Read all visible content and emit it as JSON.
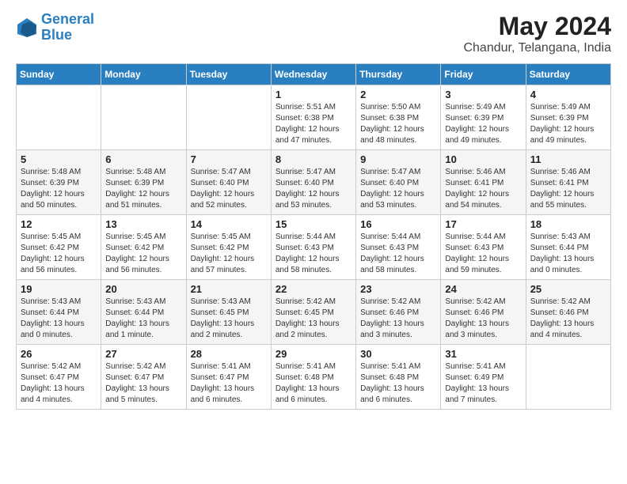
{
  "logo": {
    "line1": "General",
    "line2": "Blue"
  },
  "title": "May 2024",
  "subtitle": "Chandur, Telangana, India",
  "days_of_week": [
    "Sunday",
    "Monday",
    "Tuesday",
    "Wednesday",
    "Thursday",
    "Friday",
    "Saturday"
  ],
  "weeks": [
    [
      {
        "day": "",
        "info": ""
      },
      {
        "day": "",
        "info": ""
      },
      {
        "day": "",
        "info": ""
      },
      {
        "day": "1",
        "info": "Sunrise: 5:51 AM\nSunset: 6:38 PM\nDaylight: 12 hours\nand 47 minutes."
      },
      {
        "day": "2",
        "info": "Sunrise: 5:50 AM\nSunset: 6:38 PM\nDaylight: 12 hours\nand 48 minutes."
      },
      {
        "day": "3",
        "info": "Sunrise: 5:49 AM\nSunset: 6:39 PM\nDaylight: 12 hours\nand 49 minutes."
      },
      {
        "day": "4",
        "info": "Sunrise: 5:49 AM\nSunset: 6:39 PM\nDaylight: 12 hours\nand 49 minutes."
      }
    ],
    [
      {
        "day": "5",
        "info": "Sunrise: 5:48 AM\nSunset: 6:39 PM\nDaylight: 12 hours\nand 50 minutes."
      },
      {
        "day": "6",
        "info": "Sunrise: 5:48 AM\nSunset: 6:39 PM\nDaylight: 12 hours\nand 51 minutes."
      },
      {
        "day": "7",
        "info": "Sunrise: 5:47 AM\nSunset: 6:40 PM\nDaylight: 12 hours\nand 52 minutes."
      },
      {
        "day": "8",
        "info": "Sunrise: 5:47 AM\nSunset: 6:40 PM\nDaylight: 12 hours\nand 53 minutes."
      },
      {
        "day": "9",
        "info": "Sunrise: 5:47 AM\nSunset: 6:40 PM\nDaylight: 12 hours\nand 53 minutes."
      },
      {
        "day": "10",
        "info": "Sunrise: 5:46 AM\nSunset: 6:41 PM\nDaylight: 12 hours\nand 54 minutes."
      },
      {
        "day": "11",
        "info": "Sunrise: 5:46 AM\nSunset: 6:41 PM\nDaylight: 12 hours\nand 55 minutes."
      }
    ],
    [
      {
        "day": "12",
        "info": "Sunrise: 5:45 AM\nSunset: 6:42 PM\nDaylight: 12 hours\nand 56 minutes."
      },
      {
        "day": "13",
        "info": "Sunrise: 5:45 AM\nSunset: 6:42 PM\nDaylight: 12 hours\nand 56 minutes."
      },
      {
        "day": "14",
        "info": "Sunrise: 5:45 AM\nSunset: 6:42 PM\nDaylight: 12 hours\nand 57 minutes."
      },
      {
        "day": "15",
        "info": "Sunrise: 5:44 AM\nSunset: 6:43 PM\nDaylight: 12 hours\nand 58 minutes."
      },
      {
        "day": "16",
        "info": "Sunrise: 5:44 AM\nSunset: 6:43 PM\nDaylight: 12 hours\nand 58 minutes."
      },
      {
        "day": "17",
        "info": "Sunrise: 5:44 AM\nSunset: 6:43 PM\nDaylight: 12 hours\nand 59 minutes."
      },
      {
        "day": "18",
        "info": "Sunrise: 5:43 AM\nSunset: 6:44 PM\nDaylight: 13 hours\nand 0 minutes."
      }
    ],
    [
      {
        "day": "19",
        "info": "Sunrise: 5:43 AM\nSunset: 6:44 PM\nDaylight: 13 hours\nand 0 minutes."
      },
      {
        "day": "20",
        "info": "Sunrise: 5:43 AM\nSunset: 6:44 PM\nDaylight: 13 hours\nand 1 minute."
      },
      {
        "day": "21",
        "info": "Sunrise: 5:43 AM\nSunset: 6:45 PM\nDaylight: 13 hours\nand 2 minutes."
      },
      {
        "day": "22",
        "info": "Sunrise: 5:42 AM\nSunset: 6:45 PM\nDaylight: 13 hours\nand 2 minutes."
      },
      {
        "day": "23",
        "info": "Sunrise: 5:42 AM\nSunset: 6:46 PM\nDaylight: 13 hours\nand 3 minutes."
      },
      {
        "day": "24",
        "info": "Sunrise: 5:42 AM\nSunset: 6:46 PM\nDaylight: 13 hours\nand 3 minutes."
      },
      {
        "day": "25",
        "info": "Sunrise: 5:42 AM\nSunset: 6:46 PM\nDaylight: 13 hours\nand 4 minutes."
      }
    ],
    [
      {
        "day": "26",
        "info": "Sunrise: 5:42 AM\nSunset: 6:47 PM\nDaylight: 13 hours\nand 4 minutes."
      },
      {
        "day": "27",
        "info": "Sunrise: 5:42 AM\nSunset: 6:47 PM\nDaylight: 13 hours\nand 5 minutes."
      },
      {
        "day": "28",
        "info": "Sunrise: 5:41 AM\nSunset: 6:47 PM\nDaylight: 13 hours\nand 6 minutes."
      },
      {
        "day": "29",
        "info": "Sunrise: 5:41 AM\nSunset: 6:48 PM\nDaylight: 13 hours\nand 6 minutes."
      },
      {
        "day": "30",
        "info": "Sunrise: 5:41 AM\nSunset: 6:48 PM\nDaylight: 13 hours\nand 6 minutes."
      },
      {
        "day": "31",
        "info": "Sunrise: 5:41 AM\nSunset: 6:49 PM\nDaylight: 13 hours\nand 7 minutes."
      },
      {
        "day": "",
        "info": ""
      }
    ]
  ]
}
